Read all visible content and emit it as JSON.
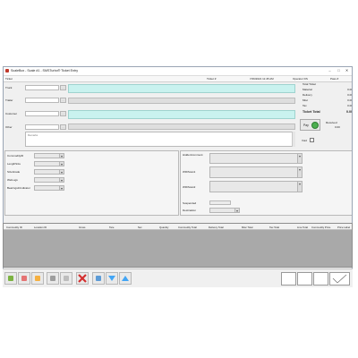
{
  "window": {
    "title": "ScaleBox - Scale #1  -  SMSTurbo® Ticket Entry",
    "min_label": "–",
    "max_label": "□",
    "close_label": "✕"
  },
  "header": {
    "ticket_label": "Ticket",
    "ticket_no_label": "Ticket #",
    "datetime": "7/26/2021 11:45 AM",
    "operator": "Operator DS",
    "pass": "Pass #"
  },
  "form": {
    "truck_label": "Truck",
    "trailer_label": "Trailer",
    "customer_label": "Customer",
    "other_label": "Other",
    "remarks_placeholder": "Remarks",
    "lookup_label": "..."
  },
  "totals": {
    "header": "Total Ticket",
    "rows": [
      {
        "label": "Material",
        "value": "0.00"
      },
      {
        "label": "Delivery",
        "value": "0.00"
      },
      {
        "label": "Misc",
        "value": "0.00"
      },
      {
        "label": "Tax",
        "value": "0.00"
      }
    ],
    "ticket_total_label": "Ticket Total",
    "ticket_total_value": "0.00",
    "pay_label": "Pay",
    "received_label": "Received",
    "received_value": "0.00",
    "void_label": "Void"
  },
  "left_fields": [
    "CommodityID",
    "LengthSize",
    "SizeGrade",
    "WetLogs",
    "BearingsInIndicator"
  ],
  "right_fields": {
    "hidden_comment": "HiddenComment",
    "wid_scan1": "WIDScan1",
    "wid_scan2": "WIDScan2",
    "suspended": "Suspended",
    "destination": "Destination"
  },
  "grid_columns": [
    "Commodity ID",
    "Location ID",
    "Gross",
    "Tare",
    "Net",
    "Quantity",
    "Commodity Total",
    "Delivery Total",
    "Misc Total",
    "Tax Total",
    "Line Total",
    "Commodity Price",
    "Price Label"
  ],
  "toolbar": {
    "icons": [
      "add-icon",
      "cut-icon",
      "folder-icon",
      "scale-icon",
      "check-icon",
      "delete-icon",
      "weigh-in-icon",
      "sort-down-icon",
      "sort-up-icon"
    ]
  }
}
